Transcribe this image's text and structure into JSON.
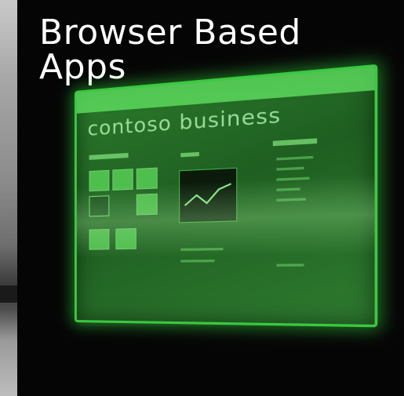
{
  "slide": {
    "title": "Browser Based Apps"
  },
  "screen": {
    "brand": "contoso business",
    "accent_color": "#39c93f"
  }
}
